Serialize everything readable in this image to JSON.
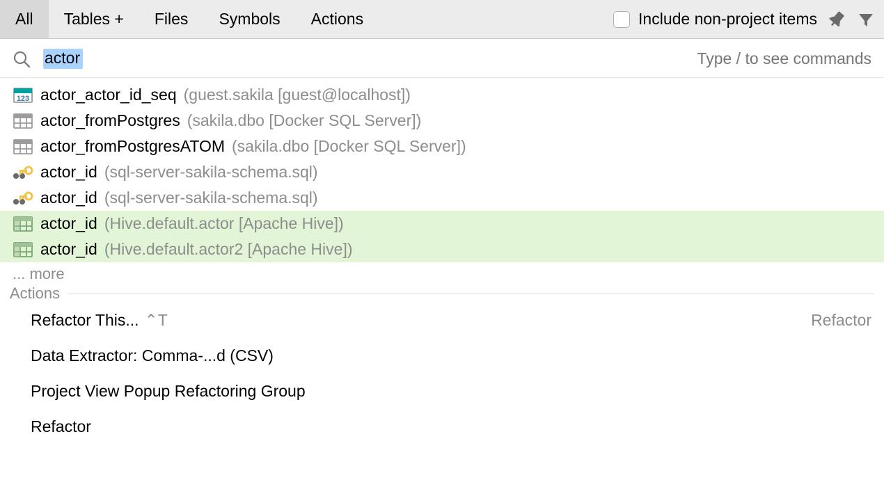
{
  "tabs": {
    "all": "All",
    "tables": "Tables +",
    "files": "Files",
    "symbols": "Symbols",
    "actions": "Actions"
  },
  "include_non_project_label": "Include non-project items",
  "search": {
    "query": "actor",
    "hint": "Type / to see commands"
  },
  "results": [
    {
      "icon": "sequence",
      "name": "actor_actor_id_seq",
      "loc": "(guest.sakila [guest@localhost])",
      "hl": false
    },
    {
      "icon": "table",
      "name": "actor_fromPostgres",
      "loc": "(sakila.dbo [Docker SQL Server])",
      "hl": false
    },
    {
      "icon": "table",
      "name": "actor_fromPostgresATOM",
      "loc": "(sakila.dbo [Docker SQL Server])",
      "hl": false
    },
    {
      "icon": "key",
      "name": "actor_id",
      "loc": "(sql-server-sakila-schema.sql)",
      "hl": false
    },
    {
      "icon": "key",
      "name": "actor_id",
      "loc": "(sql-server-sakila-schema.sql)",
      "hl": false
    },
    {
      "icon": "hivecol",
      "name": "actor_id",
      "loc": "(Hive.default.actor [Apache Hive])",
      "hl": true
    },
    {
      "icon": "hivecol",
      "name": "actor_id",
      "loc": "(Hive.default.actor2 [Apache Hive])",
      "hl": true
    }
  ],
  "more_label": "... more",
  "actions_header": "Actions",
  "actions": [
    {
      "label": "Refactor This...",
      "shortcut": "⌃T",
      "right": "Refactor"
    },
    {
      "label": "Data Extractor: Comma-...d (CSV)",
      "shortcut": "",
      "right": ""
    },
    {
      "label": "Project View Popup Refactoring Group",
      "shortcut": "",
      "right": ""
    },
    {
      "label": "Refactor",
      "shortcut": "",
      "right": ""
    }
  ]
}
